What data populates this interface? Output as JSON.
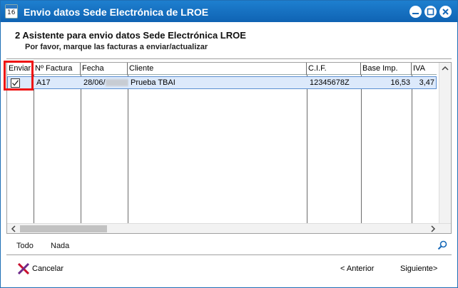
{
  "window": {
    "title": "Envio datos Sede Electrónica de LROE",
    "icon": "calendar-icon",
    "icon_number": "16"
  },
  "wizard": {
    "step_number": "2",
    "step_title": "Asistente para envio datos Sede Electrónica LROE",
    "instruction": "Por favor, marque las facturas a enviar/actualizar"
  },
  "table": {
    "columns": [
      "Enviar",
      "Nº Factura",
      "Fecha",
      "Cliente",
      "C.I.F.",
      "Base Imp.",
      "IVA"
    ],
    "rows": [
      {
        "enviar": true,
        "factura": "A17",
        "fecha": "28/06/",
        "cliente": "Prueba TBAI",
        "cif": "12345678Z",
        "base": "16,53",
        "iva": "3,47"
      }
    ]
  },
  "actions": {
    "todo": "Todo",
    "nada": "Nada",
    "cancel": "Cancelar",
    "prev": "< Anterior",
    "next": "Siguiente>"
  },
  "colors": {
    "title_bar": "#1769b8",
    "row_selected": "#dce9fb",
    "highlight": "#e11111"
  }
}
